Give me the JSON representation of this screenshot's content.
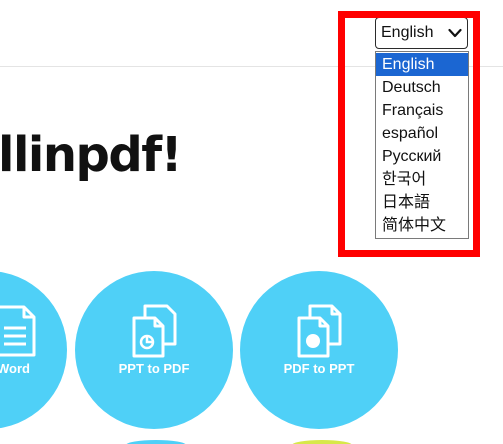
{
  "headline": "llinpdf!",
  "language": {
    "selected": "English",
    "options": [
      "English",
      "Deutsch",
      "Français",
      "español",
      "Русский",
      "한국어",
      "日本語",
      "简体中文"
    ],
    "highlight_color": "#ff0000",
    "selected_option_color": "#1b66d2"
  },
  "tools": [
    {
      "label": "Word",
      "icon": "word-document-icon"
    },
    {
      "label": "PPT to PDF",
      "icon": "ppt-to-pdf-icon"
    },
    {
      "label": "PDF to PPT",
      "icon": "pdf-to-ppt-icon"
    }
  ],
  "colors": {
    "tool_circle": "#4fd0f7"
  }
}
